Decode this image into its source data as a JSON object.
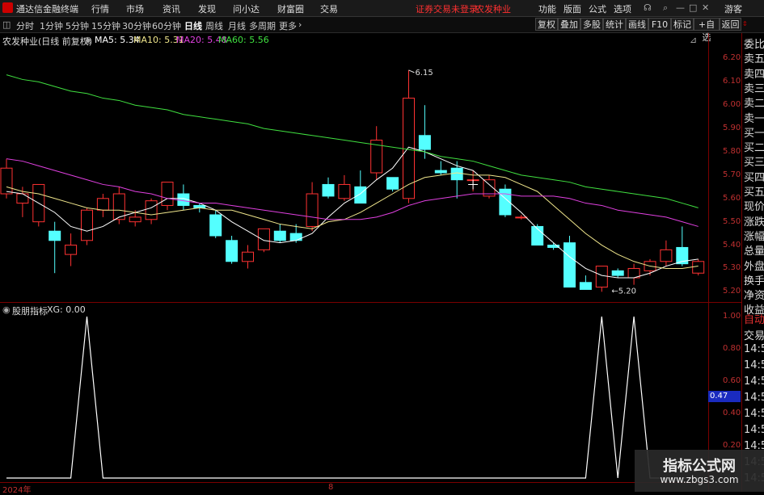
{
  "app": {
    "title": "通达信金融终端",
    "menu": [
      "行情",
      "市场",
      "资讯",
      "发现",
      "问小达",
      "财富圈",
      "交易"
    ],
    "status_red": "证券交易未登录",
    "stock_name_top": "农发种业",
    "right_menu": [
      "功能",
      "版面",
      "公式",
      "选项"
    ],
    "guest": "游客"
  },
  "toolbar": {
    "periods": [
      "分时",
      "1分钟",
      "5分钟",
      "15分钟",
      "30分钟",
      "60分钟",
      "日线",
      "周线",
      "月线",
      "多周期",
      "更多"
    ],
    "active_period": "日线",
    "right_buttons": [
      "复权",
      "叠加",
      "多股",
      "统计",
      "画线",
      "F10",
      "标记",
      "+自选",
      "返回"
    ]
  },
  "main_chart": {
    "stock_label": "农发种业(日线 前复权)",
    "ma": [
      {
        "label": "MA5: 5.34",
        "color": "#ffffff"
      },
      {
        "label": "MA10: 5.31",
        "color": "#f0e68c"
      },
      {
        "label": "MA20: 5.48",
        "color": "#e040e0"
      },
      {
        "label": "MA60: 5.56",
        "color": "#40e040"
      }
    ],
    "high_label": "6.15",
    "low_label": "5.20",
    "y_ticks": [
      "6.20",
      "6.10",
      "6.00",
      "5.90",
      "5.80",
      "5.70",
      "5.60",
      "5.50",
      "5.40",
      "5.30",
      "5.20"
    ]
  },
  "chart_data": {
    "type": "candlestick",
    "ylim": [
      5.17,
      6.25
    ],
    "candles": [
      {
        "o": 5.62,
        "h": 5.77,
        "l": 5.6,
        "c": 5.73
      },
      {
        "o": 5.58,
        "h": 5.65,
        "l": 5.52,
        "c": 5.62
      },
      {
        "o": 5.5,
        "h": 5.62,
        "l": 5.48,
        "c": 5.66
      },
      {
        "o": 5.46,
        "h": 5.5,
        "l": 5.28,
        "c": 5.42
      },
      {
        "o": 5.36,
        "h": 5.45,
        "l": 5.31,
        "c": 5.4
      },
      {
        "o": 5.42,
        "h": 5.56,
        "l": 5.4,
        "c": 5.55
      },
      {
        "o": 5.55,
        "h": 5.62,
        "l": 5.52,
        "c": 5.6
      },
      {
        "o": 5.51,
        "h": 5.65,
        "l": 5.49,
        "c": 5.62
      },
      {
        "o": 5.5,
        "h": 5.55,
        "l": 5.48,
        "c": 5.52
      },
      {
        "o": 5.51,
        "h": 5.6,
        "l": 5.49,
        "c": 5.59
      },
      {
        "o": 5.57,
        "h": 5.67,
        "l": 5.55,
        "c": 5.67
      },
      {
        "o": 5.62,
        "h": 5.66,
        "l": 5.55,
        "c": 5.57
      },
      {
        "o": 5.57,
        "h": 5.58,
        "l": 5.54,
        "c": 5.56
      },
      {
        "o": 5.53,
        "h": 5.55,
        "l": 5.43,
        "c": 5.44
      },
      {
        "o": 5.42,
        "h": 5.44,
        "l": 5.32,
        "c": 5.33
      },
      {
        "o": 5.33,
        "h": 5.4,
        "l": 5.3,
        "c": 5.37
      },
      {
        "o": 5.38,
        "h": 5.47,
        "l": 5.37,
        "c": 5.47
      },
      {
        "o": 5.46,
        "h": 5.49,
        "l": 5.41,
        "c": 5.42
      },
      {
        "o": 5.45,
        "h": 5.49,
        "l": 5.41,
        "c": 5.42
      },
      {
        "o": 5.48,
        "h": 5.67,
        "l": 5.46,
        "c": 5.62
      },
      {
        "o": 5.66,
        "h": 5.69,
        "l": 5.6,
        "c": 5.61
      },
      {
        "o": 5.6,
        "h": 5.7,
        "l": 5.59,
        "c": 5.66
      },
      {
        "o": 5.65,
        "h": 5.72,
        "l": 5.58,
        "c": 5.58
      },
      {
        "o": 5.71,
        "h": 5.91,
        "l": 5.68,
        "c": 5.85
      },
      {
        "o": 5.69,
        "h": 5.69,
        "l": 5.63,
        "c": 5.64
      },
      {
        "o": 5.6,
        "h": 6.15,
        "l": 5.58,
        "c": 6.03
      },
      {
        "o": 5.87,
        "h": 6.0,
        "l": 5.77,
        "c": 5.81
      },
      {
        "o": 5.72,
        "h": 5.76,
        "l": 5.7,
        "c": 5.71
      },
      {
        "o": 5.73,
        "h": 5.76,
        "l": 5.6,
        "c": 5.68
      },
      {
        "o": 5.68,
        "h": 5.72,
        "l": 5.63,
        "c": 5.68
      },
      {
        "o": 5.61,
        "h": 5.7,
        "l": 5.6,
        "c": 5.68
      },
      {
        "o": 5.64,
        "h": 5.66,
        "l": 5.52,
        "c": 5.53
      },
      {
        "o": 5.52,
        "h": 5.53,
        "l": 5.51,
        "c": 5.52
      },
      {
        "o": 5.48,
        "h": 5.49,
        "l": 5.4,
        "c": 5.4
      },
      {
        "o": 5.4,
        "h": 5.41,
        "l": 5.38,
        "c": 5.39
      },
      {
        "o": 5.41,
        "h": 5.44,
        "l": 5.22,
        "c": 5.22
      },
      {
        "o": 5.24,
        "h": 5.27,
        "l": 5.21,
        "c": 5.21
      },
      {
        "o": 5.22,
        "h": 5.31,
        "l": 5.2,
        "c": 5.31
      },
      {
        "o": 5.29,
        "h": 5.3,
        "l": 5.26,
        "c": 5.27
      },
      {
        "o": 5.26,
        "h": 5.32,
        "l": 5.23,
        "c": 5.3
      },
      {
        "o": 5.29,
        "h": 5.34,
        "l": 5.27,
        "c": 5.33
      },
      {
        "o": 5.33,
        "h": 5.42,
        "l": 5.31,
        "c": 5.38
      },
      {
        "o": 5.39,
        "h": 5.48,
        "l": 5.31,
        "c": 5.32
      },
      {
        "o": 5.28,
        "h": 5.34,
        "l": 5.27,
        "c": 5.33
      }
    ],
    "ma_series": [
      {
        "name": "MA5",
        "color": "#ffffff",
        "values": [
          5.63,
          5.62,
          5.58,
          5.54,
          5.48,
          5.46,
          5.48,
          5.52,
          5.54,
          5.56,
          5.6,
          5.6,
          5.58,
          5.55,
          5.5,
          5.46,
          5.42,
          5.41,
          5.42,
          5.45,
          5.52,
          5.58,
          5.62,
          5.68,
          5.73,
          5.82,
          5.8,
          5.77,
          5.74,
          5.72,
          5.66,
          5.6,
          5.54,
          5.47,
          5.41,
          5.35,
          5.3,
          5.27,
          5.26,
          5.26,
          5.28,
          5.31,
          5.33,
          5.34
        ]
      },
      {
        "name": "MA10",
        "color": "#f0e68c",
        "values": [
          5.65,
          5.63,
          5.62,
          5.6,
          5.58,
          5.56,
          5.55,
          5.55,
          5.54,
          5.53,
          5.54,
          5.55,
          5.56,
          5.55,
          5.55,
          5.53,
          5.51,
          5.49,
          5.48,
          5.47,
          5.5,
          5.51,
          5.54,
          5.58,
          5.62,
          5.66,
          5.69,
          5.7,
          5.71,
          5.7,
          5.7,
          5.69,
          5.66,
          5.63,
          5.57,
          5.51,
          5.45,
          5.4,
          5.36,
          5.33,
          5.31,
          5.3,
          5.3,
          5.31
        ]
      },
      {
        "name": "MA20",
        "color": "#e040e0",
        "values": [
          5.77,
          5.76,
          5.74,
          5.72,
          5.7,
          5.68,
          5.66,
          5.65,
          5.63,
          5.62,
          5.6,
          5.59,
          5.58,
          5.58,
          5.57,
          5.56,
          5.55,
          5.54,
          5.53,
          5.52,
          5.51,
          5.51,
          5.51,
          5.52,
          5.54,
          5.57,
          5.59,
          5.6,
          5.61,
          5.62,
          5.62,
          5.62,
          5.61,
          5.61,
          5.61,
          5.6,
          5.58,
          5.57,
          5.55,
          5.54,
          5.53,
          5.52,
          5.5,
          5.48
        ]
      },
      {
        "name": "MA60",
        "color": "#40e040",
        "values": [
          6.13,
          6.11,
          6.1,
          6.08,
          6.06,
          6.05,
          6.03,
          6.02,
          6.0,
          5.99,
          5.98,
          5.96,
          5.95,
          5.94,
          5.93,
          5.92,
          5.9,
          5.89,
          5.88,
          5.87,
          5.86,
          5.85,
          5.84,
          5.83,
          5.82,
          5.81,
          5.8,
          5.78,
          5.77,
          5.76,
          5.74,
          5.72,
          5.7,
          5.69,
          5.68,
          5.67,
          5.65,
          5.64,
          5.63,
          5.62,
          5.61,
          5.6,
          5.58,
          5.56
        ]
      }
    ],
    "indicator": {
      "name": "XG",
      "ylim": [
        0,
        1.0
      ],
      "values": [
        0,
        0,
        0,
        0,
        0,
        1,
        0,
        0,
        0,
        0,
        0,
        0,
        0,
        0,
        0,
        0,
        0,
        0,
        0,
        0,
        0,
        0,
        0,
        0,
        0,
        0,
        0,
        0,
        0,
        0,
        0,
        0,
        0,
        0,
        0,
        0,
        0,
        1,
        0,
        1,
        0,
        0,
        0,
        0
      ]
    }
  },
  "sub_chart": {
    "label": "股朋指标",
    "xg_label": "XG: 0.00",
    "y_ticks": [
      "1.00",
      "0.80",
      "0.60",
      "0.40",
      "0.20"
    ],
    "cursor_value": "0.47"
  },
  "x_axis": {
    "year_label": "2024年",
    "month_label": "8"
  },
  "right_panel": {
    "items": [
      "委比",
      "卖五",
      "卖四",
      "卖三",
      "卖二",
      "卖一",
      "买一",
      "买二",
      "买三",
      "买四",
      "买五",
      "现价",
      "涨跌",
      "涨幅",
      "总量",
      "外盘",
      "换手",
      "净资",
      "收益"
    ],
    "lower_items": [
      "自动",
      "交易",
      "14:56",
      "14:56",
      "14:56",
      "14:56",
      "14:56",
      "14:56",
      "14:56",
      "14:56",
      "14:56"
    ]
  },
  "watermark": {
    "line1": "指标公式网",
    "line2": "www.zbgs3.com"
  }
}
